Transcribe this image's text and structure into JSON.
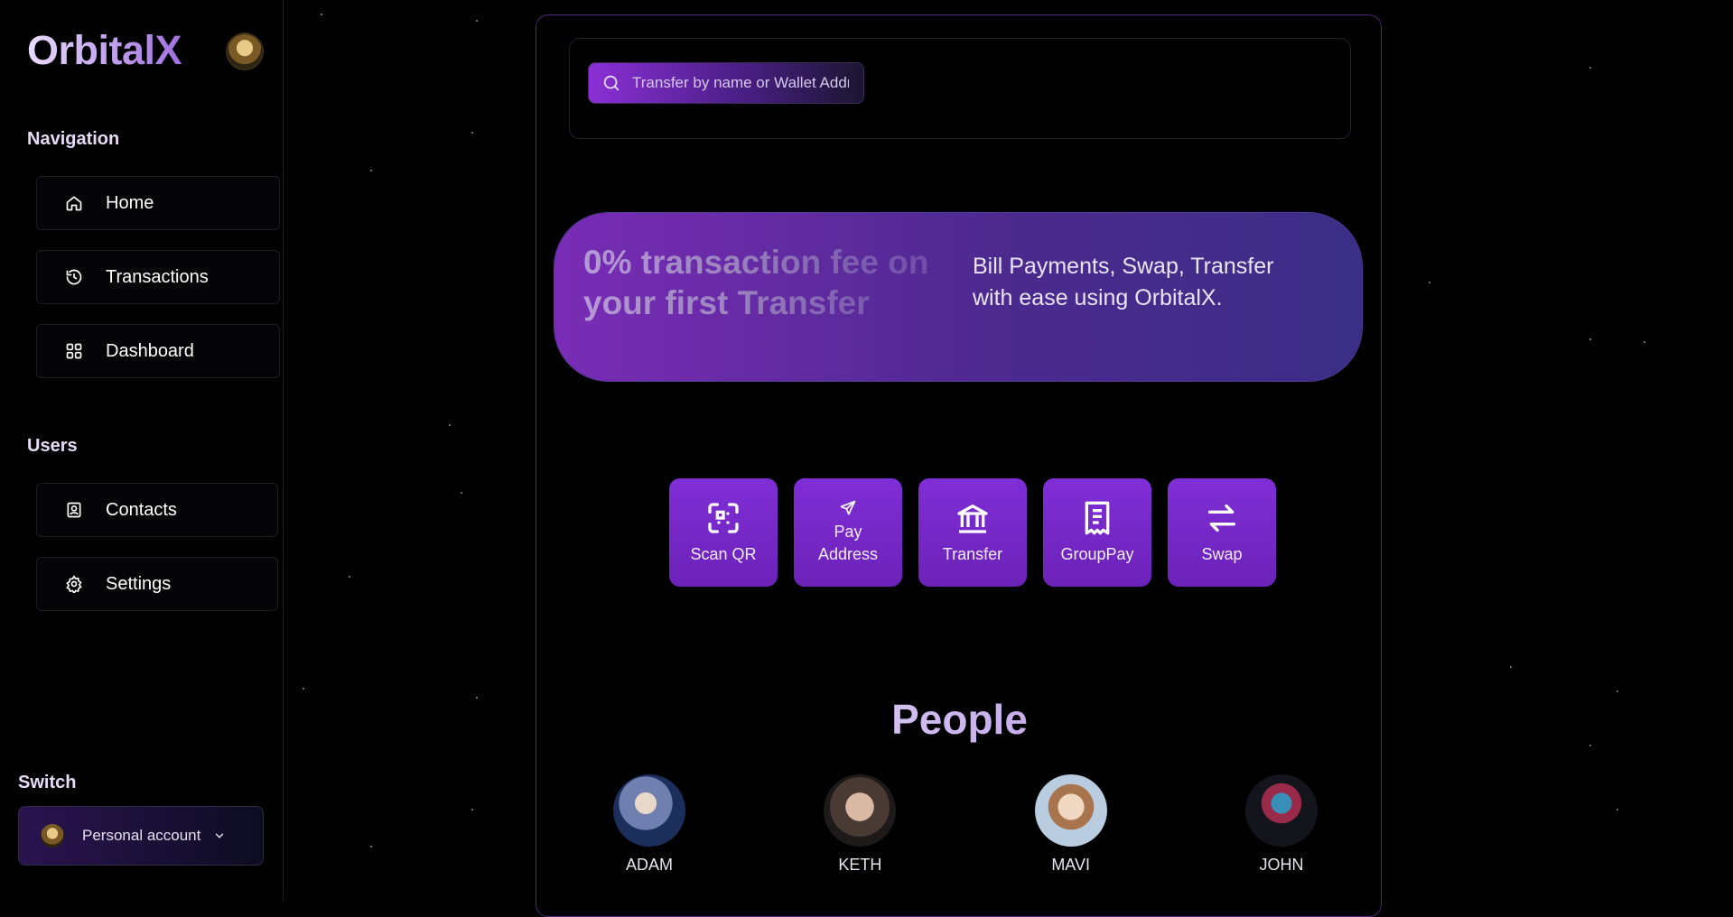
{
  "sidebar": {
    "logo": "OrbitalX",
    "navigation_title": "Navigation",
    "navigation": [
      {
        "label": "Home",
        "icon": "home-icon"
      },
      {
        "label": "Transactions",
        "icon": "history-icon"
      },
      {
        "label": "Dashboard",
        "icon": "grid-icon"
      }
    ],
    "users_title": "Users",
    "users": [
      {
        "label": "Contacts",
        "icon": "contact-icon"
      },
      {
        "label": "Settings",
        "icon": "gear-icon"
      }
    ],
    "switch_title": "Switch",
    "account_label": "Personal account"
  },
  "search": {
    "placeholder": "Transfer by name or Wallet Address"
  },
  "banner": {
    "promo": "0% transaction fee on your first Transfer",
    "description": "Bill Payments, Swap, Transfer with ease using OrbitalX."
  },
  "actions": [
    {
      "label": "Scan QR",
      "icon": "scan-qr-icon"
    },
    {
      "label": "Pay Address",
      "icon": "send-icon"
    },
    {
      "label": "Transfer",
      "icon": "bank-icon"
    },
    {
      "label": "GroupPay",
      "icon": "receipt-icon"
    },
    {
      "label": "Swap",
      "icon": "swap-icon"
    }
  ],
  "people_title": "People",
  "people": [
    {
      "name": "ADAM"
    },
    {
      "name": "KETH"
    },
    {
      "name": "MAVI"
    },
    {
      "name": "JOHN"
    }
  ],
  "colors": {
    "accent": "#7f2ed6",
    "background": "#000000"
  }
}
